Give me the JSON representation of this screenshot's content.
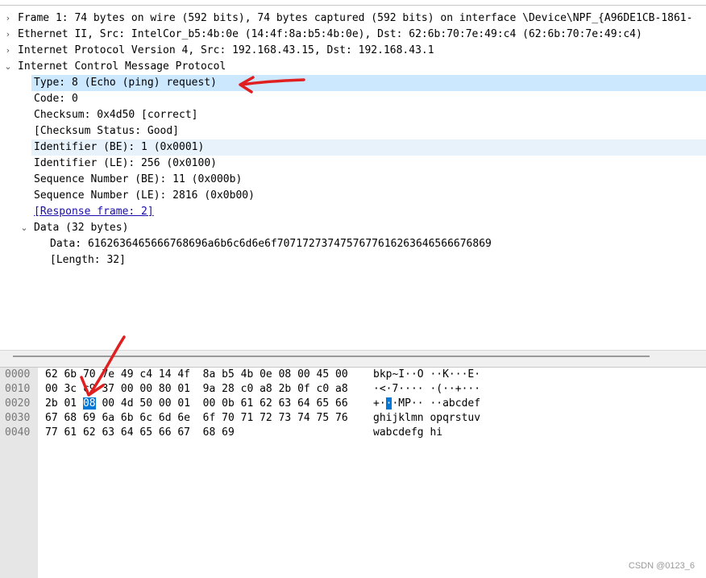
{
  "tree": [
    {
      "text": "Frame 1: 74 bytes on wire (592 bits), 74 bytes captured (592 bits) on interface \\Device\\NPF_{A96DE1CB-1861-",
      "level": 0,
      "arrow": "›"
    },
    {
      "text": "Ethernet II, Src: IntelCor_b5:4b:0e (14:4f:8a:b5:4b:0e), Dst: 62:6b:70:7e:49:c4 (62:6b:70:7e:49:c4)",
      "level": 0,
      "arrow": "›"
    },
    {
      "text": "Internet Protocol Version 4, Src: 192.168.43.15, Dst: 192.168.43.1",
      "level": 0,
      "arrow": "›"
    },
    {
      "text": "Internet Control Message Protocol",
      "level": 0,
      "arrow": "⌄"
    },
    {
      "text": "Type: 8 (Echo (ping) request)",
      "level": 1,
      "arrow": "",
      "state": "selected"
    },
    {
      "text": "Code: 0",
      "level": 1,
      "arrow": ""
    },
    {
      "text": "Checksum: 0x4d50 [correct]",
      "level": 1,
      "arrow": ""
    },
    {
      "text": "[Checksum Status: Good]",
      "level": 1,
      "arrow": ""
    },
    {
      "text": "Identifier (BE): 1 (0x0001)",
      "level": 1,
      "arrow": "",
      "state": "related"
    },
    {
      "text": "Identifier (LE): 256 (0x0100)",
      "level": 1,
      "arrow": ""
    },
    {
      "text": "Sequence Number (BE): 11 (0x000b)",
      "level": 1,
      "arrow": ""
    },
    {
      "text": "Sequence Number (LE): 2816 (0x0b00)",
      "level": 1,
      "arrow": ""
    },
    {
      "text": "[Response frame: 2]",
      "level": 1,
      "arrow": "",
      "link": true
    },
    {
      "text": "Data (32 bytes)",
      "level": 1,
      "arrow": "⌄"
    },
    {
      "text": "Data: 6162636465666768696a6b6c6d6e6f7071727374757677616263646566676869",
      "level": 2,
      "arrow": ""
    },
    {
      "text": "[Length: 32]",
      "level": 2,
      "arrow": ""
    }
  ],
  "bytes": [
    {
      "offset": "0000",
      "hex": [
        "62 6b 70 7e 49 c4 14 4f  8a b5 4b 0e 08 00 45 00"
      ],
      "ascii": [
        "bkp~I··O ··K···E·"
      ]
    },
    {
      "offset": "0010",
      "hex": [
        "00 3c c9 37 00 00 80 01  9a 28 c0 a8 2b 0f c0 a8"
      ],
      "ascii": [
        "·<·7···· ·(··+···"
      ]
    },
    {
      "offset": "0020",
      "hex": [
        "2b 01 ",
        "08",
        " 00 4d 50 00 01  00 0b 61 62 63 64 65 66"
      ],
      "ascii": [
        "+·",
        "·",
        "·MP·· ··abcdef"
      ]
    },
    {
      "offset": "0030",
      "hex": [
        "67 68 69 6a 6b 6c 6d 6e  6f 70 71 72 73 74 75 76"
      ],
      "ascii": [
        "ghijklmn opqrstuv"
      ]
    },
    {
      "offset": "0040",
      "hex": [
        "77 61 62 63 64 65 66 67  68 69"
      ],
      "ascii": [
        "wabcdefg hi"
      ]
    }
  ],
  "watermark": "CSDN @0123_6",
  "colors": {
    "selected_row": "#cce8ff",
    "byte_highlight": "#0078d7",
    "annotation_arrow": "#e02020"
  }
}
